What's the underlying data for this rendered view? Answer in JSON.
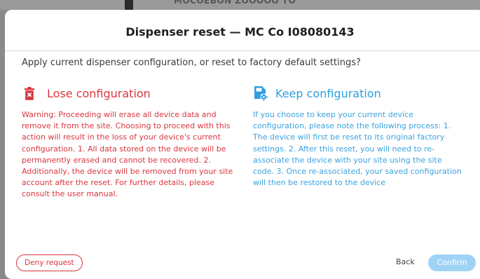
{
  "background": {
    "partial_title": "MOCOEBON ZOOOOO TO"
  },
  "dialog": {
    "title": "Dispenser reset — MC Co I08080143",
    "question": "Apply current dispenser configuration, or reset to factory default settings?",
    "lose": {
      "icon": "trash-icon",
      "title": "Lose configuration",
      "body": "Warning: Proceeding will erase all device data and remove it from the site. Choosing to proceed with this action will result in the loss of your device's current configuration. 1. All data stored on the device will be permanently erased and cannot be recovered. 2. Additionally, the device will be removed from your site account after the reset. For further details, please consult the user manual."
    },
    "keep": {
      "icon": "file-settings-icon",
      "title": "Keep configuration",
      "body": "If you choose to keep your current device configuration, please note the following process: 1. The device will first be reset to its original factory settings. 2. After this reset, you will need to re-associate the device with your site using the site code. 3. Once re-associated, your saved configuration will then be restored to the device"
    },
    "buttons": {
      "deny": "Deny request",
      "back": "Back",
      "confirm": "Confirm"
    }
  },
  "colors": {
    "danger": "#d9363e",
    "info": "#2f9fe0",
    "confirm_disabled": "#9fd3f5"
  }
}
